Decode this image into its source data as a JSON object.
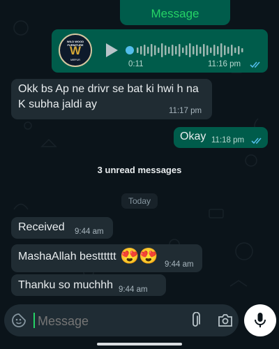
{
  "header": {
    "message_button": "Message"
  },
  "voice_note": {
    "avatar_text_top": "WILD WOOD FURNITURE",
    "avatar_letter": "W",
    "avatar_text_bottom": "MIRPUR",
    "duration": "0:11",
    "time": "11:16 pm",
    "status": "read"
  },
  "messages_before": [
    {
      "lines": [
        "Okk bs Ap ne drivr se bat ki hwi h na",
        "K subha jaldi ay"
      ],
      "time": "11:17 pm",
      "direction": "incoming"
    },
    {
      "text": "Okay",
      "time": "11:18 pm",
      "direction": "outgoing",
      "status": "read"
    }
  ],
  "unread_banner": "3 unread messages",
  "day_separator": "Today",
  "messages_after": [
    {
      "text": "Received",
      "time": "9:44 am"
    },
    {
      "text": "MashaAllah bestttttt",
      "emoji": "😍😍",
      "time": "9:44 am"
    },
    {
      "text": "Thanku so muchhh",
      "time": "9:44 am"
    }
  ],
  "composer": {
    "placeholder": "Message"
  },
  "icons": [
    "sticker-icon",
    "attach-icon",
    "camera-icon",
    "mic-icon",
    "play-icon",
    "double-check-icon"
  ],
  "colors": {
    "background": "#0b141a",
    "incoming": "#202c33",
    "outgoing": "#005c4b",
    "accent": "#25d366",
    "read_ticks": "#53bdeb"
  }
}
